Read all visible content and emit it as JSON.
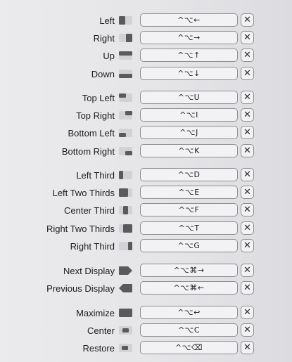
{
  "clear_glyph": "✕",
  "colors": {
    "icon_fill": "#5a5a5e",
    "icon_bg": "#d2d2d6",
    "field_border": "#8e8e93",
    "field_bg": "#f2f2f4"
  },
  "groups": [
    [
      {
        "id": "left",
        "label": "Left",
        "shortcut": "^⌥←",
        "icon": "half-left-icon"
      },
      {
        "id": "right",
        "label": "Right",
        "shortcut": "^⌥→",
        "icon": "half-right-icon"
      },
      {
        "id": "up",
        "label": "Up",
        "shortcut": "^⌥↑",
        "icon": "half-top-icon"
      },
      {
        "id": "down",
        "label": "Down",
        "shortcut": "^⌥↓",
        "icon": "half-bottom-icon"
      }
    ],
    [
      {
        "id": "top-left",
        "label": "Top Left",
        "shortcut": "^⌥U",
        "icon": "quarter-top-left-icon"
      },
      {
        "id": "top-right",
        "label": "Top Right",
        "shortcut": "^⌥I",
        "icon": "quarter-top-right-icon"
      },
      {
        "id": "bottom-left",
        "label": "Bottom Left",
        "shortcut": "^⌥J",
        "icon": "quarter-bottom-left-icon"
      },
      {
        "id": "bottom-right",
        "label": "Bottom Right",
        "shortcut": "^⌥K",
        "icon": "quarter-bottom-right-icon"
      }
    ],
    [
      {
        "id": "left-third",
        "label": "Left Third",
        "shortcut": "^⌥D",
        "icon": "third-left-icon"
      },
      {
        "id": "left-two-thirds",
        "label": "Left Two Thirds",
        "shortcut": "^⌥E",
        "icon": "two-thirds-left-icon"
      },
      {
        "id": "center-third",
        "label": "Center Third",
        "shortcut": "^⌥F",
        "icon": "third-center-icon"
      },
      {
        "id": "right-two-thirds",
        "label": "Right Two Thirds",
        "shortcut": "^⌥T",
        "icon": "two-thirds-right-icon"
      },
      {
        "id": "right-third",
        "label": "Right Third",
        "shortcut": "^⌥G",
        "icon": "third-right-icon"
      }
    ],
    [
      {
        "id": "next-display",
        "label": "Next Display",
        "shortcut": "^⌥⌘→",
        "icon": "next-display-icon"
      },
      {
        "id": "previous-display",
        "label": "Previous Display",
        "shortcut": "^⌥⌘←",
        "icon": "previous-display-icon"
      }
    ],
    [
      {
        "id": "maximize",
        "label": "Maximize",
        "shortcut": "^⌥↩",
        "icon": "maximize-icon"
      },
      {
        "id": "center",
        "label": "Center",
        "shortcut": "^⌥C",
        "icon": "center-icon"
      },
      {
        "id": "restore",
        "label": "Restore",
        "shortcut": "^⌥⌫",
        "icon": "restore-icon"
      }
    ]
  ]
}
